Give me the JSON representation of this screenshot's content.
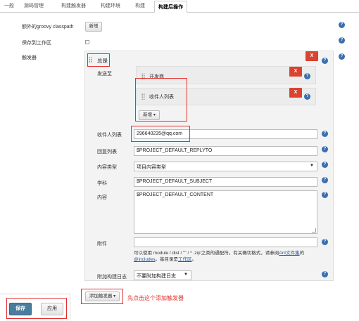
{
  "tabs": [
    "一般",
    "源码管理",
    "构建触发器",
    "构建环境",
    "构建",
    "构建后操作"
  ],
  "active_tab_label": "构建后操作",
  "top": {
    "groovy_label": "额外的groovy classpath",
    "groovy_button": "新增",
    "save_workspace_label": "保存到工作区",
    "triggers_label": "触发器"
  },
  "trigger": {
    "title": "总是",
    "send_to_label": "发送至",
    "recipients": [
      {
        "label": "开发商"
      },
      {
        "label": "收件人列表"
      }
    ],
    "add_button": "新增",
    "delete_label": "X"
  },
  "fields": {
    "recipient_list": {
      "label": "收件人列表",
      "value": "296640235@qq.com"
    },
    "reply_to": {
      "label": "回复列表",
      "value": "$PROJECT_DEFAULT_REPLYTO"
    },
    "content_type": {
      "label": "内容类型",
      "value": "项目内容类型"
    },
    "subject": {
      "label": "学科",
      "value": "$PROJECT_DEFAULT_SUBJECT"
    },
    "content": {
      "label": "内容",
      "value": "$PROJECT_DEFAULT_CONTENT"
    },
    "attachments": {
      "label": "附件",
      "value": "",
      "hint_before": "可以使用 module / dist / \"\" / * .zip'之类的通配符。有关确切格式，请参阅",
      "hint_link1": "Ant文件集",
      "hint_mid": "的",
      "hint_link2": "@includes",
      "hint_after": "。基目录是",
      "hint_link3": "工作区",
      "hint_end": "。"
    },
    "build_log": {
      "label": "附加构建日志",
      "value": "不要附加构建日志"
    }
  },
  "add_trigger": {
    "button": "添加触发器",
    "annotation": "先点击这个添加触发器"
  },
  "footer": {
    "save": "保存",
    "apply": "应用"
  },
  "colors": {
    "danger": "#d9432f",
    "primary": "#4a7c9d",
    "annotation": "#e3302f",
    "help": "#3a6fb0"
  }
}
